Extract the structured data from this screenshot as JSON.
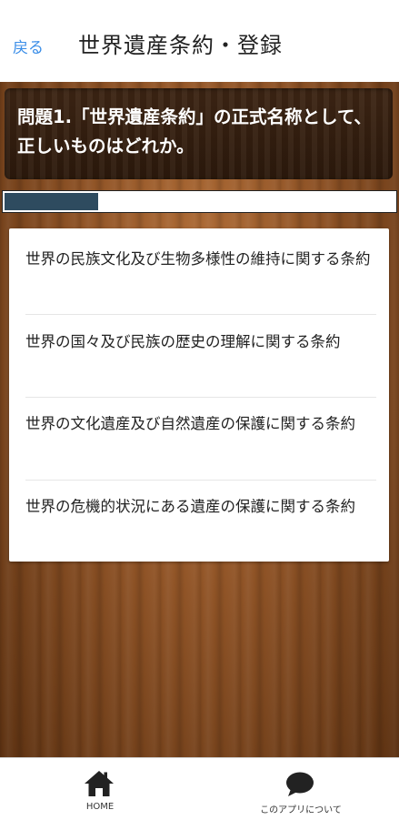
{
  "header": {
    "back_label": "戻る",
    "title": "世界遺産条約・登録"
  },
  "question": {
    "text": "問題1.「世界遺産条約」の正式名称として、正しいものはどれか。"
  },
  "progress": {
    "fraction": 0.24
  },
  "answers": [
    "世界の民族文化及び生物多様性の維持に関する条約",
    "世界の国々及び民族の歴史の理解に関する条約",
    "世界の文化遺産及び自然遺産の保護に関する条約",
    "世界の危機的状況にある遺産の保護に関する条約"
  ],
  "tabs": {
    "home": {
      "label": "HOME",
      "icon": "home-icon"
    },
    "about": {
      "label": "このアプリについて",
      "icon": "speech-bubble-icon"
    }
  },
  "colors": {
    "accent": "#3b8ee8",
    "progress_fill": "#2e4b5f",
    "question_bg": "#2f1b0d",
    "wood": "#8f5326"
  }
}
